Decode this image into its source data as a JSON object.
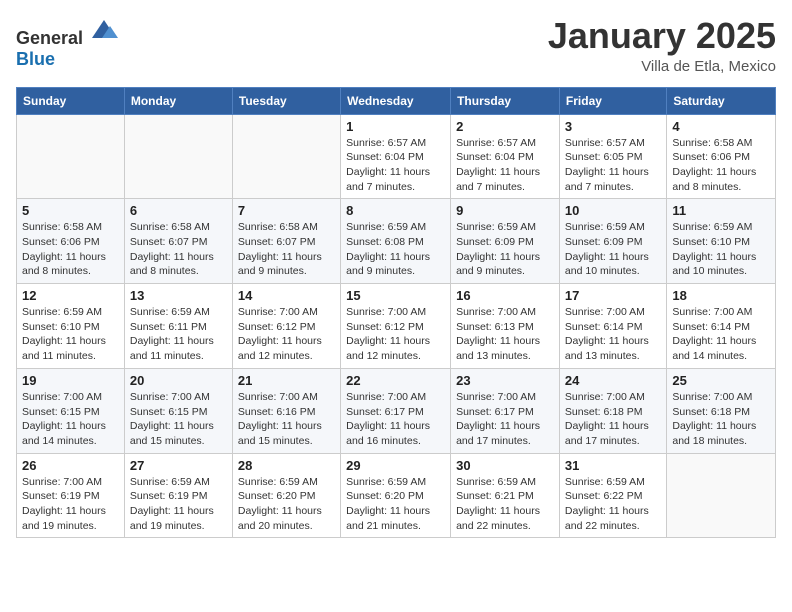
{
  "logo": {
    "general": "General",
    "blue": "Blue"
  },
  "header": {
    "title": "January 2025",
    "subtitle": "Villa de Etla, Mexico"
  },
  "days_of_week": [
    "Sunday",
    "Monday",
    "Tuesday",
    "Wednesday",
    "Thursday",
    "Friday",
    "Saturday"
  ],
  "weeks": [
    [
      {
        "day": "",
        "info": ""
      },
      {
        "day": "",
        "info": ""
      },
      {
        "day": "",
        "info": ""
      },
      {
        "day": "1",
        "info": "Sunrise: 6:57 AM\nSunset: 6:04 PM\nDaylight: 11 hours and 7 minutes."
      },
      {
        "day": "2",
        "info": "Sunrise: 6:57 AM\nSunset: 6:04 PM\nDaylight: 11 hours and 7 minutes."
      },
      {
        "day": "3",
        "info": "Sunrise: 6:57 AM\nSunset: 6:05 PM\nDaylight: 11 hours and 7 minutes."
      },
      {
        "day": "4",
        "info": "Sunrise: 6:58 AM\nSunset: 6:06 PM\nDaylight: 11 hours and 8 minutes."
      }
    ],
    [
      {
        "day": "5",
        "info": "Sunrise: 6:58 AM\nSunset: 6:06 PM\nDaylight: 11 hours and 8 minutes."
      },
      {
        "day": "6",
        "info": "Sunrise: 6:58 AM\nSunset: 6:07 PM\nDaylight: 11 hours and 8 minutes."
      },
      {
        "day": "7",
        "info": "Sunrise: 6:58 AM\nSunset: 6:07 PM\nDaylight: 11 hours and 9 minutes."
      },
      {
        "day": "8",
        "info": "Sunrise: 6:59 AM\nSunset: 6:08 PM\nDaylight: 11 hours and 9 minutes."
      },
      {
        "day": "9",
        "info": "Sunrise: 6:59 AM\nSunset: 6:09 PM\nDaylight: 11 hours and 9 minutes."
      },
      {
        "day": "10",
        "info": "Sunrise: 6:59 AM\nSunset: 6:09 PM\nDaylight: 11 hours and 10 minutes."
      },
      {
        "day": "11",
        "info": "Sunrise: 6:59 AM\nSunset: 6:10 PM\nDaylight: 11 hours and 10 minutes."
      }
    ],
    [
      {
        "day": "12",
        "info": "Sunrise: 6:59 AM\nSunset: 6:10 PM\nDaylight: 11 hours and 11 minutes."
      },
      {
        "day": "13",
        "info": "Sunrise: 6:59 AM\nSunset: 6:11 PM\nDaylight: 11 hours and 11 minutes."
      },
      {
        "day": "14",
        "info": "Sunrise: 7:00 AM\nSunset: 6:12 PM\nDaylight: 11 hours and 12 minutes."
      },
      {
        "day": "15",
        "info": "Sunrise: 7:00 AM\nSunset: 6:12 PM\nDaylight: 11 hours and 12 minutes."
      },
      {
        "day": "16",
        "info": "Sunrise: 7:00 AM\nSunset: 6:13 PM\nDaylight: 11 hours and 13 minutes."
      },
      {
        "day": "17",
        "info": "Sunrise: 7:00 AM\nSunset: 6:14 PM\nDaylight: 11 hours and 13 minutes."
      },
      {
        "day": "18",
        "info": "Sunrise: 7:00 AM\nSunset: 6:14 PM\nDaylight: 11 hours and 14 minutes."
      }
    ],
    [
      {
        "day": "19",
        "info": "Sunrise: 7:00 AM\nSunset: 6:15 PM\nDaylight: 11 hours and 14 minutes."
      },
      {
        "day": "20",
        "info": "Sunrise: 7:00 AM\nSunset: 6:15 PM\nDaylight: 11 hours and 15 minutes."
      },
      {
        "day": "21",
        "info": "Sunrise: 7:00 AM\nSunset: 6:16 PM\nDaylight: 11 hours and 15 minutes."
      },
      {
        "day": "22",
        "info": "Sunrise: 7:00 AM\nSunset: 6:17 PM\nDaylight: 11 hours and 16 minutes."
      },
      {
        "day": "23",
        "info": "Sunrise: 7:00 AM\nSunset: 6:17 PM\nDaylight: 11 hours and 17 minutes."
      },
      {
        "day": "24",
        "info": "Sunrise: 7:00 AM\nSunset: 6:18 PM\nDaylight: 11 hours and 17 minutes."
      },
      {
        "day": "25",
        "info": "Sunrise: 7:00 AM\nSunset: 6:18 PM\nDaylight: 11 hours and 18 minutes."
      }
    ],
    [
      {
        "day": "26",
        "info": "Sunrise: 7:00 AM\nSunset: 6:19 PM\nDaylight: 11 hours and 19 minutes."
      },
      {
        "day": "27",
        "info": "Sunrise: 6:59 AM\nSunset: 6:19 PM\nDaylight: 11 hours and 19 minutes."
      },
      {
        "day": "28",
        "info": "Sunrise: 6:59 AM\nSunset: 6:20 PM\nDaylight: 11 hours and 20 minutes."
      },
      {
        "day": "29",
        "info": "Sunrise: 6:59 AM\nSunset: 6:20 PM\nDaylight: 11 hours and 21 minutes."
      },
      {
        "day": "30",
        "info": "Sunrise: 6:59 AM\nSunset: 6:21 PM\nDaylight: 11 hours and 22 minutes."
      },
      {
        "day": "31",
        "info": "Sunrise: 6:59 AM\nSunset: 6:22 PM\nDaylight: 11 hours and 22 minutes."
      },
      {
        "day": "",
        "info": ""
      }
    ]
  ]
}
